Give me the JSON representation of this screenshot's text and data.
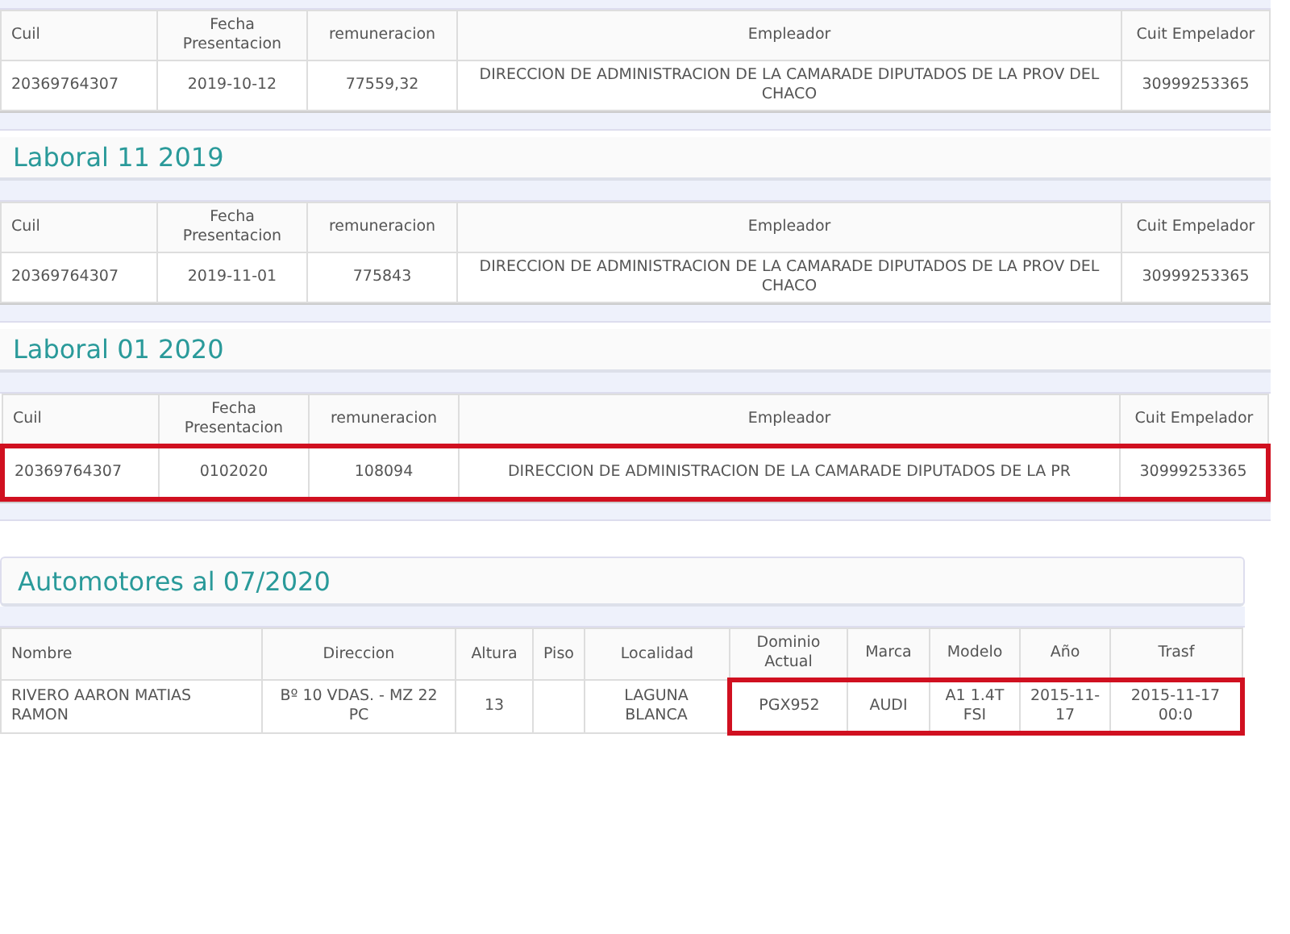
{
  "sections": [
    {
      "kind": "laboral",
      "columns": [
        "Cuil",
        "Fecha Presentacion",
        "remuneracion",
        "Empleador",
        "Cuit Empelador"
      ],
      "rows": [
        {
          "cells": [
            {
              "text": "20369764307",
              "highlighted": false
            },
            {
              "text": "2019-10-12",
              "highlighted": false
            },
            {
              "text": "77559,32",
              "highlighted": false
            },
            {
              "text": "DIRECCION DE ADMINISTRACION DE LA CAMARADE DIPUTADOS DE LA PROV DEL CHACO",
              "highlighted": false
            },
            {
              "text": "30999253365",
              "highlighted": false
            }
          ]
        }
      ]
    },
    {
      "kind": "laboral",
      "title": "Laboral 11 2019",
      "columns": [
        "Cuil",
        "Fecha Presentacion",
        "remuneracion",
        "Empleador",
        "Cuit Empelador"
      ],
      "rows": [
        {
          "cells": [
            {
              "text": "20369764307",
              "highlighted": false
            },
            {
              "text": "2019-11-01",
              "highlighted": false
            },
            {
              "text": "775843",
              "highlighted": false
            },
            {
              "text": "DIRECCION DE ADMINISTRACION DE LA CAMARADE DIPUTADOS DE LA PROV DEL CHACO",
              "highlighted": false
            },
            {
              "text": "30999253365",
              "highlighted": false
            }
          ]
        }
      ]
    },
    {
      "kind": "laboral",
      "title": "Laboral 01 2020",
      "columns": [
        "Cuil",
        "Fecha Presentacion",
        "remuneracion",
        "Empleador",
        "Cuit Empelador"
      ],
      "rows": [
        {
          "cells": [
            {
              "text": "20369764307",
              "highlighted": true
            },
            {
              "text": "0102020",
              "highlighted": true
            },
            {
              "text": "108094",
              "highlighted": true
            },
            {
              "text": "DIRECCION DE ADMINISTRACION DE LA CAMARADE DIPUTADOS DE LA PR",
              "highlighted": true
            },
            {
              "text": "30999253365",
              "highlighted": true
            }
          ]
        }
      ]
    },
    {
      "kind": "automotores",
      "title": "Automotores al 07/2020",
      "columns": [
        "Nombre",
        "Direccion",
        "Altura",
        "Piso",
        "Localidad",
        "Dominio Actual",
        "Marca",
        "Modelo",
        "Año",
        "Trasf"
      ],
      "rows": [
        {
          "cells": [
            {
              "text": "RIVERO AARON MATIAS RAMON",
              "highlighted": false
            },
            {
              "text": "Bº 10 VDAS. - MZ 22 PC",
              "highlighted": false
            },
            {
              "text": "13",
              "highlighted": false
            },
            {
              "text": "",
              "highlighted": false
            },
            {
              "text": "LAGUNA BLANCA",
              "highlighted": false
            },
            {
              "text": "PGX952",
              "highlighted": true
            },
            {
              "text": "AUDI",
              "highlighted": true
            },
            {
              "text": "A1 1.4T FSI",
              "highlighted": true
            },
            {
              "text": "2015-11-17",
              "highlighted": true
            },
            {
              "text": "2015-11-17 00:0",
              "highlighted": true
            }
          ]
        }
      ]
    }
  ]
}
